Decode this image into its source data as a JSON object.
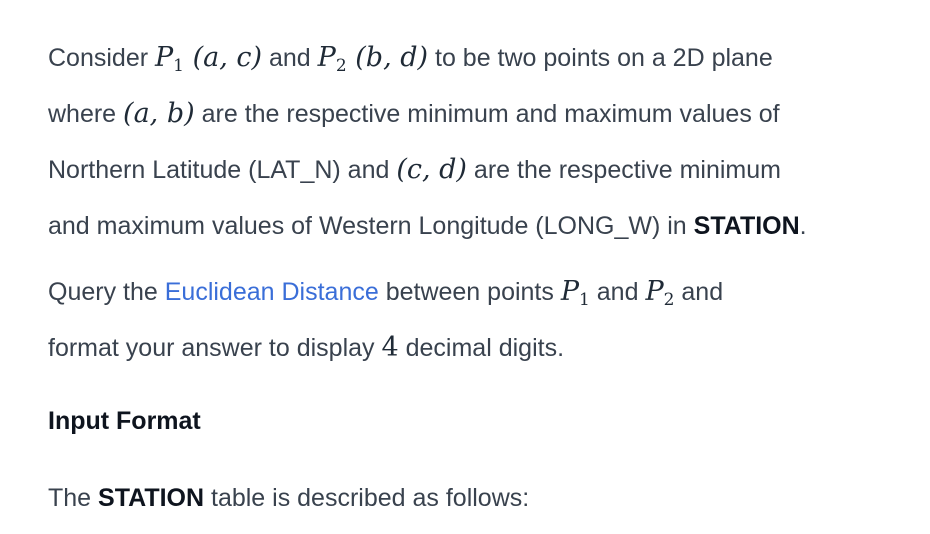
{
  "p1": {
    "t1": "Consider ",
    "P1_name": "P",
    "P1_sub": "1",
    "P1_args": "(a, c)",
    "t2": " and ",
    "P2_name": "P",
    "P2_sub": "2",
    "P2_args": "(b, d)",
    "t3": " to be two points on a 2D plane",
    "t4": "where ",
    "ab": "(a, b)",
    "t5": " are the respective minimum and maximum values of",
    "t6": "Northern Latitude (LAT_N) and ",
    "cd": "(c, d)",
    "t7": " are the respective minimum",
    "t8": "and maximum values of Western Longitude (LONG_W) in ",
    "station": "STATION",
    "t9": "."
  },
  "p2": {
    "t1": "Query the ",
    "link": "Euclidean Distance",
    "t2": " between points ",
    "P1_name": "P",
    "P1_sub": "1",
    "t3": " and ",
    "P2_name": "P",
    "P2_sub": "2",
    "t4": " and",
    "t5": "format your answer to display ",
    "digits": "4",
    "t6": " decimal digits."
  },
  "input_format": {
    "heading": "Input Format"
  },
  "p3": {
    "t1": "The ",
    "station": "STATION",
    "t2": " table is described as follows:"
  },
  "colors": {
    "text": "#39424e",
    "link": "#3a6ed8",
    "bold": "#0e141e"
  }
}
